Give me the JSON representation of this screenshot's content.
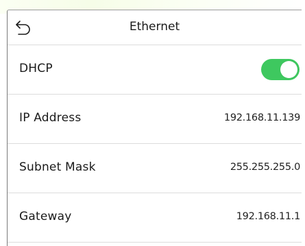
{
  "header": {
    "title": "Ethernet",
    "back_icon": "back-arrow-icon"
  },
  "settings": {
    "dhcp": {
      "label": "DHCP",
      "enabled": true,
      "toggle_color": "#3ec85f"
    },
    "ip_address": {
      "label": "IP Address",
      "value": "192.168.11.139"
    },
    "subnet_mask": {
      "label": "Subnet Mask",
      "value": "255.255.255.0"
    },
    "gateway": {
      "label": "Gateway",
      "value": "192.168.11.1"
    }
  }
}
